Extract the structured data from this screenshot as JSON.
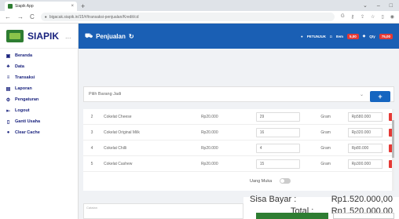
{
  "browser": {
    "tab_title": "Siapik App",
    "url": "bigacak.siapik.in/15/#/transaksi-penjualan/Kredit/cd"
  },
  "sidebar": {
    "logo_text": "SIAPIK",
    "logo_dots": "...",
    "items": [
      {
        "label": "Beranda",
        "icon": "calendar-icon"
      },
      {
        "label": "Data",
        "icon": "users-icon"
      },
      {
        "label": "Transaksi",
        "icon": "list-icon"
      },
      {
        "label": "Laporan",
        "icon": "report-icon"
      },
      {
        "label": "Pengaturan",
        "icon": "gear-icon"
      },
      {
        "label": "Logout",
        "icon": "logout-icon"
      },
      {
        "label": "Ganti Usaha",
        "icon": "swap-icon"
      },
      {
        "label": "Clear Cache",
        "icon": "cache-icon"
      }
    ]
  },
  "topbar": {
    "title": "Penjualan",
    "petunjuk": "PETUNJUK",
    "item_label": "Item",
    "item_count": "5,00",
    "qty_label": "Qty",
    "qty_count": "75,00"
  },
  "form": {
    "select_placeholder": "Pilih Barang Jadi",
    "add_label": "+"
  },
  "table": {
    "rows": [
      {
        "no": "2",
        "name": "Cokelat Cheese",
        "price": "Rp20.000",
        "qty": "29",
        "unit": "Gram",
        "subtotal": "Rp580.000"
      },
      {
        "no": "3",
        "name": "Cokelat Original Milk",
        "price": "Rp20.000",
        "qty": "16",
        "unit": "Gram",
        "subtotal": "Rp320.000"
      },
      {
        "no": "4",
        "name": "Cokelat Chilli",
        "price": "Rp20.000",
        "qty": "4",
        "unit": "Gram",
        "subtotal": "Rp80.000"
      },
      {
        "no": "5",
        "name": "Cokelat Cashew",
        "price": "Rp20.000",
        "qty": "15",
        "unit": "Gram",
        "subtotal": "Rp300.000"
      }
    ]
  },
  "summary": {
    "notes_placeholder": "Catatan",
    "total_label": "Total :",
    "total_value": "Rp1.520.000,00",
    "uang_muka_label": "Uang Muka",
    "sisa_label": "Sisa Bayar :",
    "sisa_value": "Rp1.520.000,00"
  },
  "colors": {
    "primary": "#1a5fb4",
    "danger": "#e53935",
    "success": "#2e7d32"
  }
}
